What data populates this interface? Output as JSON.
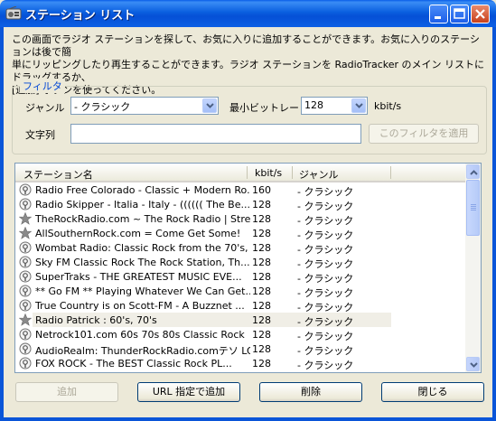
{
  "window": {
    "title": "ステーション リスト",
    "controls": {
      "minimize": "minimize",
      "maximize": "maximize",
      "close": "close"
    }
  },
  "description": {
    "line1": "この画面でラジオ ステーションを探して、お気に入りに追加することができます。お気に入りのステーションは後で簡",
    "line2": "単にリッピングしたり再生することができます。ラジオ ステーションを RadioTracker のメイン リストにドラッグするか、",
    "line3": "[追加] ボタンを使ってください。"
  },
  "filter": {
    "group_title": "フィルタ",
    "genre_label": "ジャンル",
    "genre_value": "- クラシック",
    "bitrate_label": "最小ビットレート",
    "bitrate_value": "128",
    "bitrate_unit": "kbit/s",
    "text_label": "文字列",
    "text_value": "",
    "apply_button": "このフィルタを適用"
  },
  "list": {
    "columns": [
      "ステーション名",
      "kbit/s",
      "ジャンル"
    ],
    "rows": [
      {
        "icon": "radio",
        "name": "Radio Free Colorado - Classic + Modern Ro...",
        "kbit": "160",
        "genre": "- クラシック"
      },
      {
        "icon": "radio",
        "name": "Radio Skipper - Italia - Italy - (((((( The Be...",
        "kbit": "128",
        "genre": "- クラシック"
      },
      {
        "icon": "star",
        "name": "TheRockRadio.com ~ The Rock Radio | Stre...",
        "kbit": "128",
        "genre": "- クラシック"
      },
      {
        "icon": "star",
        "name": "AllSouthernRock.com = Come Get Some!",
        "kbit": "128",
        "genre": "- クラシック"
      },
      {
        "icon": "radio",
        "name": "Wombat Radio: Classic Rock from the 70's, ...",
        "kbit": "128",
        "genre": "- クラシック"
      },
      {
        "icon": "radio",
        "name": "Sky FM Classic Rock The Rock Station, Th...",
        "kbit": "128",
        "genre": "- クラシック"
      },
      {
        "icon": "radio",
        "name": "SuperTraks - THE GREATEST MUSIC EVE...",
        "kbit": "128",
        "genre": "- クラシック"
      },
      {
        "icon": "radio",
        "name": "** Go FM ** Playing Whatever We Can Get...",
        "kbit": "128",
        "genre": "- クラシック"
      },
      {
        "icon": "radio",
        "name": "True Country is on Scott-FM - A Buzznet ...",
        "kbit": "128",
        "genre": "- クラシック"
      },
      {
        "icon": "star",
        "name": "Radio Patrick : 60's, 70's",
        "kbit": "128",
        "genre": "- クラシック",
        "selected": true
      },
      {
        "icon": "radio",
        "name": "Netrock101.com 60s 70s 80s Classic Rock",
        "kbit": "128",
        "genre": "- クラシック"
      },
      {
        "icon": "radio",
        "name": "AudioRealm: ThunderRockRadio.comテソ LOO...",
        "kbit": "128",
        "genre": "- クラシック"
      },
      {
        "icon": "radio",
        "name": "FOX ROCK - The BEST Classic Rock    PL...",
        "kbit": "128",
        "genre": "- クラシック"
      }
    ]
  },
  "buttons": {
    "add": "追加",
    "add_url": "URL 指定で追加",
    "delete": "削除",
    "close": "閉じる"
  },
  "colors": {
    "titlebar": "#0a5fdf",
    "group_title": "#0046d5",
    "dialog_bg": "#ece9d8"
  }
}
